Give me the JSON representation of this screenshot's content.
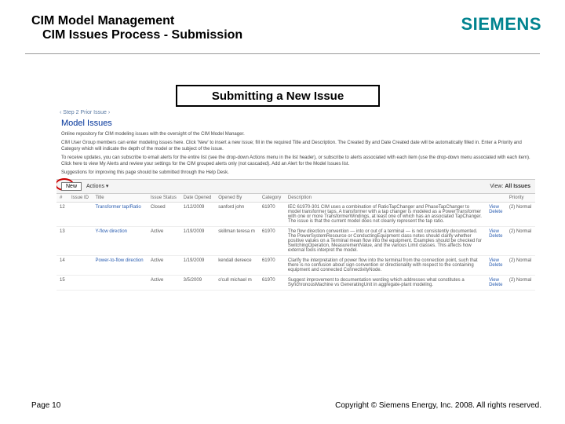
{
  "header": {
    "title_line1": "CIM Model Management",
    "title_line2": "CIM Issues Process - Submission",
    "brand": "SIEMENS"
  },
  "callout": "Submitting a New Issue",
  "screenshot": {
    "breadcrumb": "‹ Step 2  Prior Issue ›",
    "page_title": "Model Issues",
    "intro1": "Online repository for CIM modeling issues with the oversight of the CIM Model Manager.",
    "intro2": "CIM User Group members can enter modeling issues here. Click 'New' to insert a new issue; fill in the required Title and Description. The Created By and Date Created date will be automatically filled in. Enter a Priority and Category which will indicate the depth of the model or the subject of the issue.",
    "intro3": "To receive updates, you can subscribe to email alerts for the entire list (see the drop-down Actions menu in the list header), or subscribe to alerts associated with each item (use the drop-down menu associated with each item). Click here to view My Alerts and review your settings for the CIM grouped alerts only (not cascaded). Add an Alert for the Model Issues list.",
    "intro4": "Suggestions for improving this page should be submitted through the Help Desk.",
    "toolbar": {
      "new_label": "New",
      "actions_label": "Actions ▾",
      "view_label": "View:",
      "view_value": "All Issues"
    },
    "columns": [
      "#",
      "Issue ID",
      "Title",
      "Issue Status",
      "Date Opened",
      "Opened By",
      "Category",
      "Description",
      "",
      "Priority"
    ],
    "rows": [
      {
        "num": "12",
        "id": "",
        "title": "Transformer tap/Ratio",
        "status": "Closed",
        "date": "1/12/2009",
        "by": "sanford john",
        "cat": "61970",
        "desc": "IEC 61970-301 CIM uses a combination of RatioTapChanger and PhaseTapChanger to model transformer taps. A transformer with a tap changer is modeled as a PowerTransformer with one or more TransformerWindings, at least one of which has an associated TapChanger. The issue is that the current model does not cleanly represent the tap ratio.",
        "act1": "View",
        "act2": "Delete",
        "pri": "(2) Normal"
      },
      {
        "num": "13",
        "id": "",
        "title": "Y-flow direction",
        "status": "Active",
        "date": "1/19/2009",
        "by": "skillman teresa m",
        "cat": "61970",
        "desc": "The flow direction convention — into or out of a terminal — is not consistently documented. The PowerSystemResource or ConductingEquipment class notes should clarify whether positive values on a Terminal mean flow into the equipment. Examples should be checked for SwitchingOperation, MeasurementValue, and the various Limit classes. This affects how external tools interpret the model.",
        "act1": "View",
        "act2": "Delete",
        "pri": "(2) Normal"
      },
      {
        "num": "14",
        "id": "",
        "title": "Power-to-flow direction",
        "status": "Active",
        "date": "1/19/2009",
        "by": "kendall dereece",
        "cat": "61970",
        "desc": "Clarify the interpretation of power flow into the terminal from the connection point, such that there is no confusion about sign convention or directionality with respect to the containing equipment and connected ConnectivityNode.",
        "act1": "View",
        "act2": "Delete",
        "pri": "(2) Normal"
      },
      {
        "num": "15",
        "id": "",
        "title": "",
        "status": "Active",
        "date": "3/5/2009",
        "by": "o'cull michael m",
        "cat": "61970",
        "desc": "Suggest improvement to documentation wording which addresses what constitutes a SynchronousMachine vs GeneratingUnit in aggregate-plant modeling.",
        "act1": "View",
        "act2": "Delete",
        "pri": "(2) Normal"
      }
    ]
  },
  "footer": {
    "page": "Page 10",
    "copyright": "Copyright © Siemens Energy, Inc. 2008. All rights reserved."
  }
}
